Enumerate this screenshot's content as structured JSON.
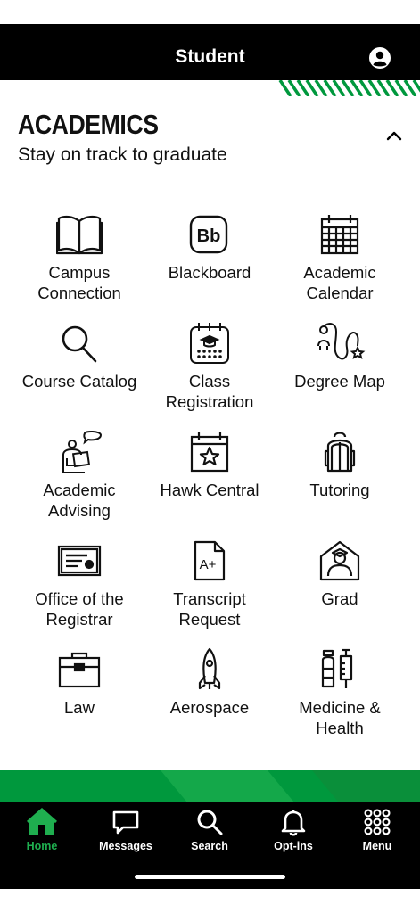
{
  "header": {
    "title": "Student",
    "account_icon": "account-circle-icon"
  },
  "section": {
    "title": "ACADEMICS",
    "subtitle": "Stay on track to graduate",
    "toggle_icon": "chevron-up-icon"
  },
  "tiles": [
    {
      "label": "Campus Connection",
      "icon": "book-icon"
    },
    {
      "label": "Blackboard",
      "icon": "blackboard-icon"
    },
    {
      "label": "Academic Calendar",
      "icon": "calendar-grid-icon"
    },
    {
      "label": "Course Catalog",
      "icon": "magnifier-icon"
    },
    {
      "label": "Class Registration",
      "icon": "registration-calendar-icon"
    },
    {
      "label": "Degree Map",
      "icon": "path-map-icon"
    },
    {
      "label": "Academic Advising",
      "icon": "advisor-speech-icon"
    },
    {
      "label": "Hawk Central",
      "icon": "star-calendar-icon"
    },
    {
      "label": "Tutoring",
      "icon": "backpack-icon"
    },
    {
      "label": "Office of the Registrar",
      "icon": "certificate-icon"
    },
    {
      "label": "Transcript Request",
      "icon": "graded-document-icon"
    },
    {
      "label": "Grad",
      "icon": "graduate-house-icon"
    },
    {
      "label": "Law",
      "icon": "briefcase-icon"
    },
    {
      "label": "Aerospace",
      "icon": "rocket-icon"
    },
    {
      "label": "Medicine & Health",
      "icon": "medicine-syringe-icon"
    }
  ],
  "nav": [
    {
      "label": "Home",
      "icon": "home-icon",
      "active": true
    },
    {
      "label": "Messages",
      "icon": "chat-bubble-icon",
      "active": false
    },
    {
      "label": "Search",
      "icon": "search-icon",
      "active": false
    },
    {
      "label": "Opt-ins",
      "icon": "bell-icon",
      "active": false
    },
    {
      "label": "Menu",
      "icon": "grid-dots-icon",
      "active": false
    }
  ],
  "colors": {
    "brand_green": "#00983d",
    "nav_active": "#1fae4f",
    "bar": "#000000"
  }
}
